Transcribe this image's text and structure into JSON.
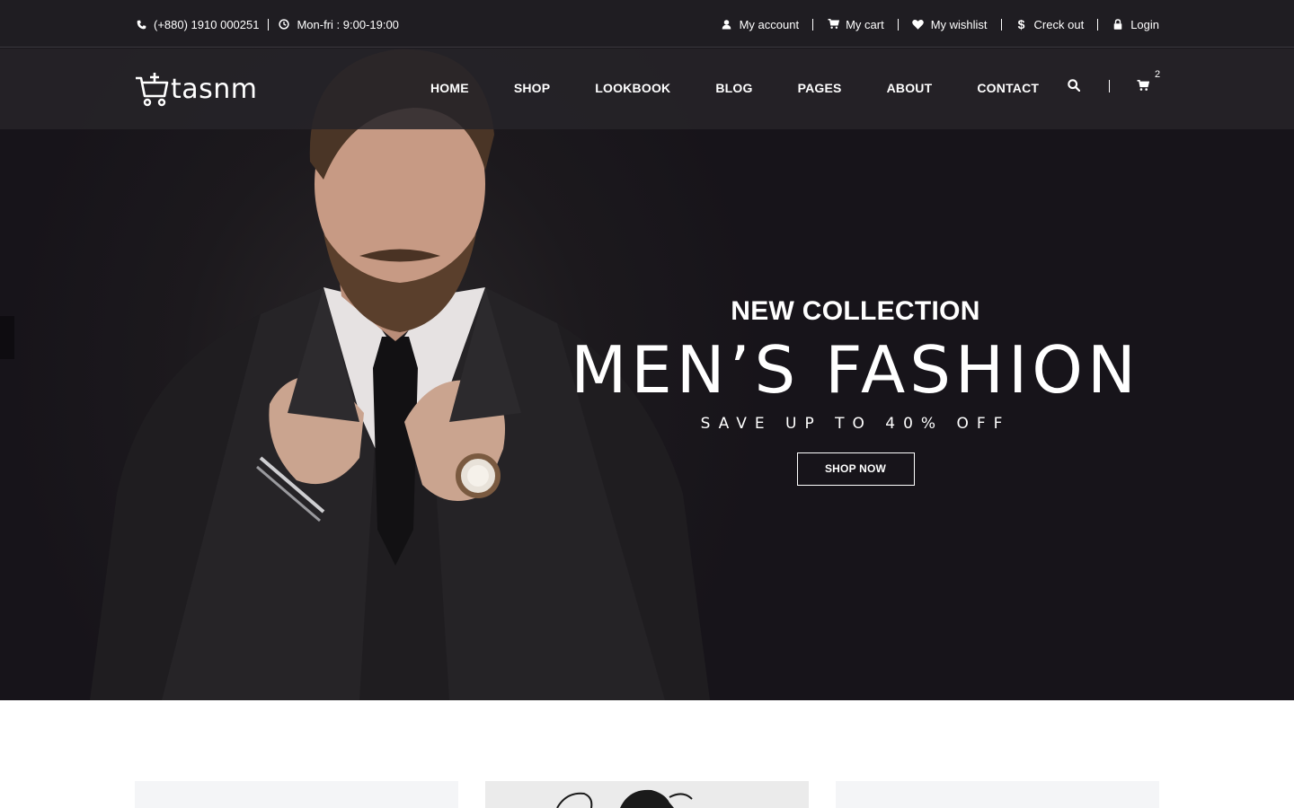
{
  "topbar": {
    "phone": "(+880) 1910 000251",
    "hours": "Mon-fri : 9:00-19:00",
    "links": [
      {
        "label": "My account",
        "icon": "user-icon"
      },
      {
        "label": "My cart",
        "icon": "cart-icon"
      },
      {
        "label": "My wishlist",
        "icon": "heart-icon"
      },
      {
        "label": "Creck out",
        "icon": "dollar-icon"
      },
      {
        "label": "Login",
        "icon": "lock-icon"
      }
    ]
  },
  "brand": {
    "name": "tasnm"
  },
  "nav": {
    "items": [
      "HOME",
      "SHOP",
      "LOOKBOOK",
      "BLOG",
      "PAGES",
      "ABOUT",
      "CONTACT"
    ],
    "cart_count": "2"
  },
  "hero": {
    "eyebrow": "NEW COLLECTION",
    "headline": "MEN’S FASHION",
    "subline": "SAVE UP TO 40% OFF",
    "button": "SHOP NOW"
  },
  "colors": {
    "hero_bg": "#17141a",
    "topbar_bg": "#201e23",
    "navbar_bg": "#262429",
    "text": "#ffffff",
    "card_bg": "#f4f5f7"
  }
}
